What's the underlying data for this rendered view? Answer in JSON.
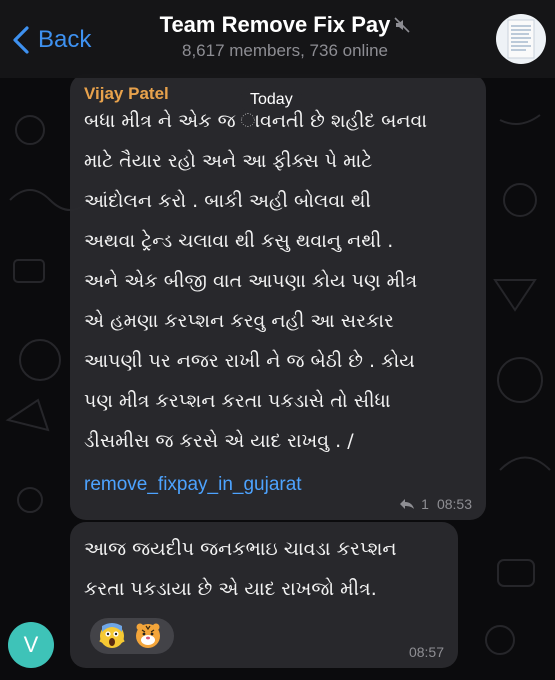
{
  "header": {
    "back_label": "Back",
    "title": "Team Remove Fix Pay",
    "subtitle": "8,617 members, 736 online",
    "muted": true
  },
  "date_separator": "Today",
  "messages": [
    {
      "sender": "Vijay Patel",
      "lines": [
        "બધા મીત્ર ને એક જ ાવનતી છે શહીદ બનવા",
        "માટે તૈયાર રહો અને આ ફીક્સ પે માટે",
        "આંદોલન કરો . બાકી અહી બોલવા થી",
        "અથવા ટ્રેન્ડ ચલાવા થી કસુ થવાનુ નથી .",
        "અને એક બીજી વાત આપણા કોય પણ મીત્ર",
        "એ હમણા કરપ્શન કરવુ નહી આ સરકાર",
        "આપણી પર નજર રાખી ને જ બેઠી છે . કોય",
        "પણ મીત્ર કરપ્શન કરતા પકડાસે તો સીધા",
        "ડીસમીસ જ કરસે એ યાદ રાખવુ . /"
      ],
      "link": "remove_fixpay_in_gujarat",
      "reply_count": "1",
      "time": "08:53"
    },
    {
      "lines": [
        "આજ જયદીપ જનકભાઇ ચાવડા કરપ્શન",
        "કરતા પકડાયા છે એ યાદ રાખજો મીત્ર."
      ],
      "reactions": [
        "😱",
        "🐯"
      ],
      "time": "08:57"
    }
  ],
  "avatar_initial": "V",
  "colors": {
    "accent": "#3e91f0",
    "sender_name": "#e8a24c",
    "link": "#4da3ff",
    "avatar": "#3ec3b8"
  }
}
